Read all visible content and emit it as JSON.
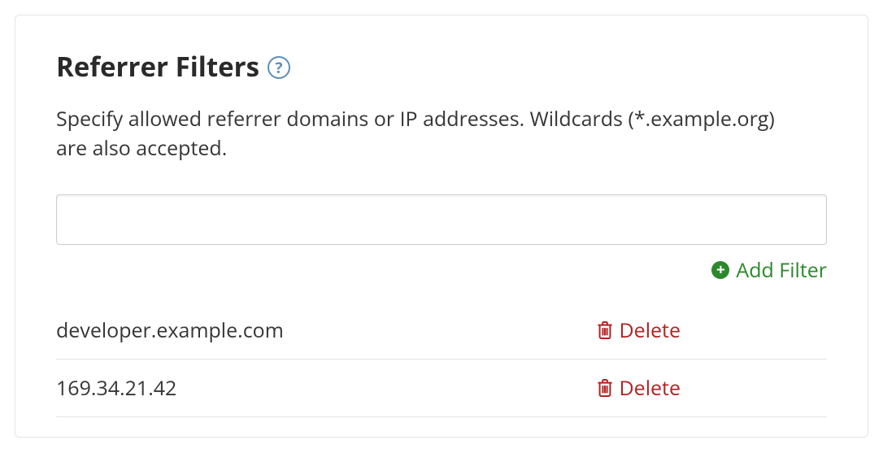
{
  "panel": {
    "title": "Referrer Filters",
    "help_glyph": "?",
    "description": "Specify allowed referrer domains or IP addresses. Wildcards (*.example.org) are also accepted.",
    "input_value": "",
    "input_placeholder": "",
    "add_filter_label": "Add Filter",
    "filters": [
      {
        "value": "developer.example.com",
        "delete_label": "Delete"
      },
      {
        "value": "169.34.21.42",
        "delete_label": "Delete"
      }
    ]
  },
  "colors": {
    "accent_green": "#2c882c",
    "danger_red": "#b32222",
    "help_blue": "#5e8eb8",
    "border": "#e3e3e3"
  }
}
